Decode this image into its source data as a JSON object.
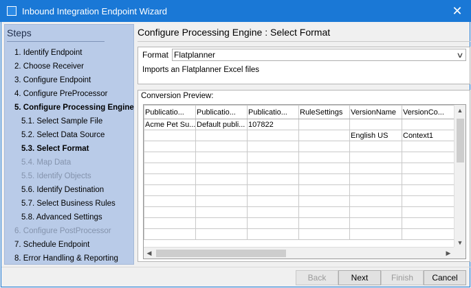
{
  "window": {
    "title": "Inbound Integration Endpoint Wizard",
    "close_glyph": "✕"
  },
  "steps": {
    "header": "Steps",
    "items": [
      {
        "label": "1. Identify Endpoint",
        "state": "normal",
        "level": 0
      },
      {
        "label": "2. Choose Receiver",
        "state": "normal",
        "level": 0
      },
      {
        "label": "3. Configure Endpoint",
        "state": "normal",
        "level": 0
      },
      {
        "label": "4. Configure PreProcessor",
        "state": "normal",
        "level": 0
      },
      {
        "label": "5. Configure Processing Engine",
        "state": "active",
        "level": 0
      },
      {
        "label": "5.1. Select Sample File",
        "state": "normal",
        "level": 1
      },
      {
        "label": "5.2. Select Data Source",
        "state": "normal",
        "level": 1
      },
      {
        "label": "5.3. Select Format",
        "state": "active",
        "level": 1
      },
      {
        "label": "5.4. Map Data",
        "state": "disabled",
        "level": 1
      },
      {
        "label": "5.5. Identify Objects",
        "state": "disabled",
        "level": 1
      },
      {
        "label": "5.6. Identify Destination",
        "state": "normal",
        "level": 1
      },
      {
        "label": "5.7. Select Business Rules",
        "state": "normal",
        "level": 1
      },
      {
        "label": "5.8. Advanced Settings",
        "state": "normal",
        "level": 1
      },
      {
        "label": "6. Configure PostProcessor",
        "state": "disabled",
        "level": 0
      },
      {
        "label": "7. Schedule Endpoint",
        "state": "normal",
        "level": 0
      },
      {
        "label": "8. Error Handling & Reporting",
        "state": "normal",
        "level": 0
      }
    ]
  },
  "main": {
    "title": "Configure Processing Engine : Select Format",
    "format_label": "Format",
    "format_value": "Flatplanner",
    "format_description": "Imports an Flatplanner Excel files",
    "preview_label": "Conversion Preview:",
    "columns": [
      "Publicatio...",
      "Publicatio...",
      "Publicatio...",
      "RuleSettings",
      "VersionName",
      "VersionCo..."
    ],
    "rows": [
      [
        "Acme Pet Su...",
        "Default publi...",
        "107822",
        "",
        "",
        ""
      ],
      [
        "",
        "",
        "",
        "",
        "English US",
        "Context1"
      ],
      [
        "",
        "",
        "",
        "",
        "",
        ""
      ],
      [
        "",
        "",
        "",
        "",
        "",
        ""
      ],
      [
        "",
        "",
        "",
        "",
        "",
        ""
      ],
      [
        "",
        "",
        "",
        "",
        "",
        ""
      ],
      [
        "",
        "",
        "",
        "",
        "",
        ""
      ],
      [
        "",
        "",
        "",
        "",
        "",
        ""
      ],
      [
        "",
        "",
        "",
        "",
        "",
        ""
      ],
      [
        "",
        "",
        "",
        "",
        "",
        ""
      ],
      [
        "",
        "",
        "",
        "",
        "",
        ""
      ]
    ]
  },
  "buttons": {
    "back": "Back",
    "next": "Next",
    "finish": "Finish",
    "cancel": "Cancel"
  },
  "colors": {
    "titlebar": "#1a78d6",
    "steps_panel": "#b9cbe8",
    "disabled_text": "#8493ac"
  }
}
